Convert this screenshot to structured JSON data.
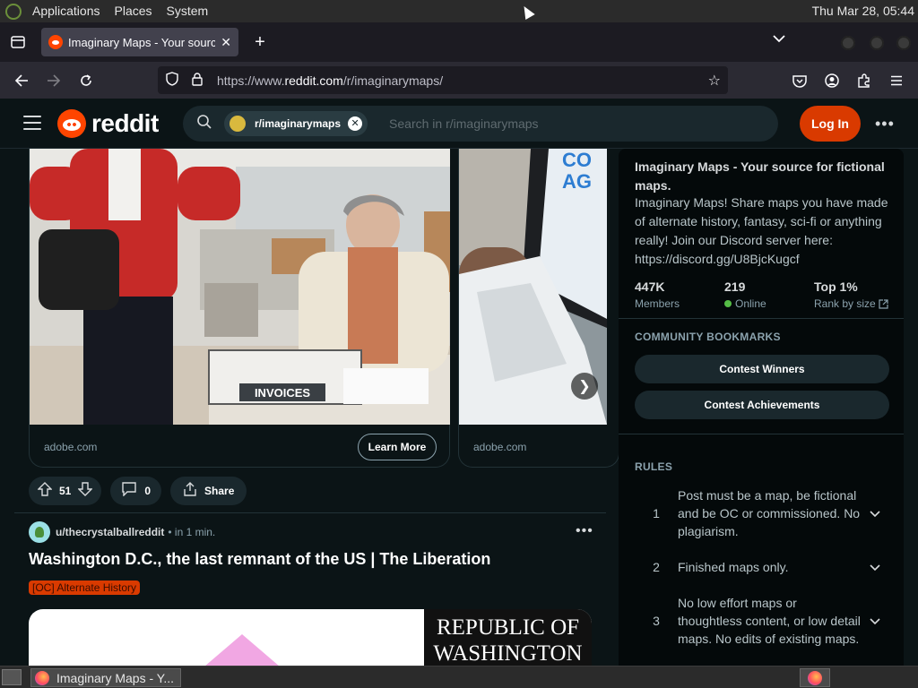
{
  "desktop": {
    "menus": [
      "Applications",
      "Places",
      "System"
    ],
    "clock": "Thu Mar 28, 05:44"
  },
  "browser": {
    "tab_title": "Imaginary Maps - Your sourc",
    "url_prefix": "https://www.",
    "url_domain": "reddit.com",
    "url_path": "/r/imaginarymaps/"
  },
  "header": {
    "logo_text": "reddit",
    "search_chip": "r/imaginarymaps",
    "search_placeholder": "Search in r/imaginarymaps",
    "login_label": "Log In"
  },
  "ad": {
    "card1_label": "INVOICES",
    "card1_domain": "adobe.com",
    "learn_more": "Learn More",
    "card2_domain": "adobe.com"
  },
  "actions": {
    "votes": "51",
    "comments": "0",
    "share": "Share"
  },
  "post": {
    "author": "u/thecrystalballreddit",
    "time": "• in 1 min.",
    "title": "Washington D.C., the last remnant of the US | The Liberation",
    "flair": "[OC] Alternate History",
    "image_text_line1": "REPUBLIC OF",
    "image_text_line2": "WASHINGTON"
  },
  "sidebar": {
    "title": "Imaginary Maps - Your source for fictional maps.",
    "description": "Imaginary Maps! Share maps you have made of alternate history, fantasy, sci-fi or anything really! Join our Discord server here: https://discord.gg/U8BjcKugcf",
    "stats": [
      {
        "value": "447K",
        "label": "Members"
      },
      {
        "value": "219",
        "label": "Online"
      },
      {
        "value": "Top 1%",
        "label": "Rank by size"
      }
    ],
    "bookmarks_heading": "COMMUNITY BOOKMARKS",
    "bookmarks": [
      "Contest Winners",
      "Contest Achievements"
    ],
    "rules_heading": "RULES",
    "rules": [
      {
        "num": "1",
        "text": "Post must be a map, be fictional and be OC or commissioned. No plagiarism."
      },
      {
        "num": "2",
        "text": "Finished maps only."
      },
      {
        "num": "3",
        "text": "No low effort maps or thoughtless content, or low detail maps. No edits of existing maps."
      }
    ]
  },
  "taskbar": {
    "window_label": "Imaginary Maps - Y..."
  },
  "colors": {
    "background": "#0b1416",
    "brand_orange": "#ff4500",
    "login_button": "#d93a00",
    "online_green": "#55bd46"
  }
}
